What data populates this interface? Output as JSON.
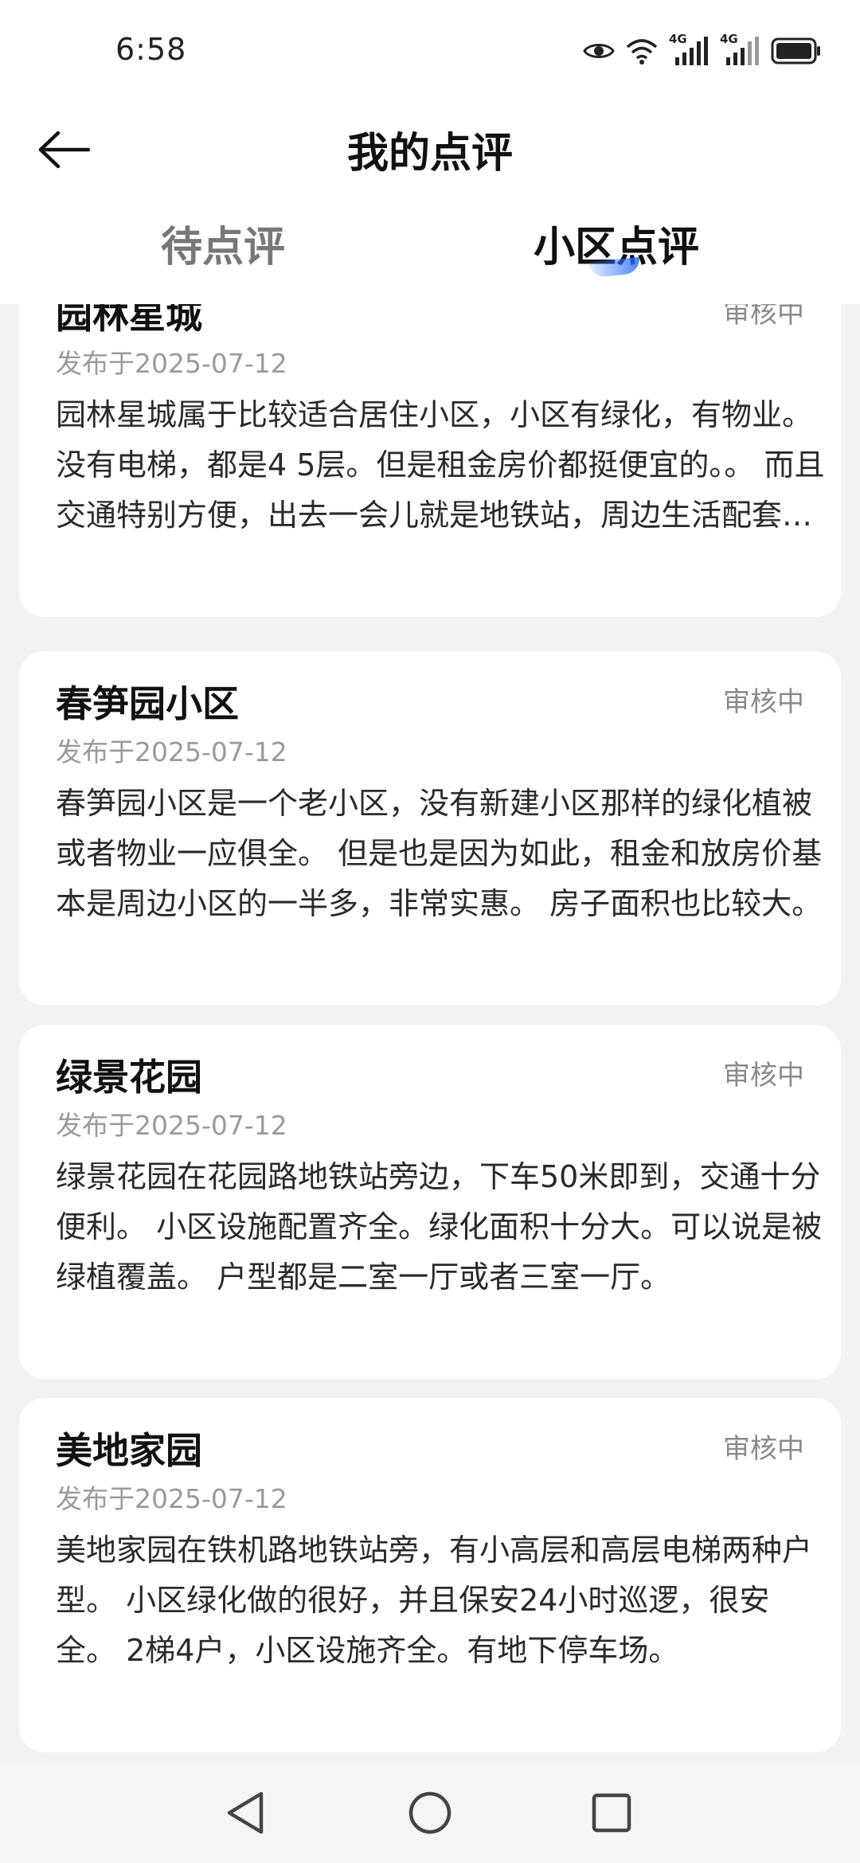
{
  "status_bar": {
    "time": "6:58",
    "network_1": "4G",
    "network_2": "4G"
  },
  "header": {
    "title": "我的点评"
  },
  "tabs": [
    {
      "label": "待点评",
      "active": false
    },
    {
      "label": "小区点评",
      "active": true
    }
  ],
  "reviews": [
    {
      "name": "园林星城",
      "status": "审核中",
      "date": "发布于2025-07-12",
      "content": "园林星城属于比较适合居住小区，小区有绿化，有物业。 没有电梯，都是4 5层。但是租金房价都挺便宜的。。 而且交通特别方便，出去一会儿就是地铁站，周边生活配套也很齐全。"
    },
    {
      "name": "春笋园小区",
      "status": "审核中",
      "date": "发布于2025-07-12",
      "content": "春笋园小区是一个老小区，没有新建小区那样的绿化植被或者物业一应俱全。 但是也是因为如此，租金和放房价基本是周边小区的一半多，非常实惠。 房子面积也比较大。"
    },
    {
      "name": "绿景花园",
      "status": "审核中",
      "date": "发布于2025-07-12",
      "content": "绿景花园在花园路地铁站旁边，下车50米即到，交通十分便利。 小区设施配置齐全。绿化面积十分大。可以说是被绿植覆盖。 户型都是二室一厅或者三室一厅。"
    },
    {
      "name": "美地家园",
      "status": "审核中",
      "date": "发布于2025-07-12",
      "content": "美地家园在铁机路地铁站旁，有小高层和高层电梯两种户型。 小区绿化做的很好，并且保安24小时巡逻，很安全。 2梯4户，小区设施齐全。有地下停车场。"
    }
  ]
}
